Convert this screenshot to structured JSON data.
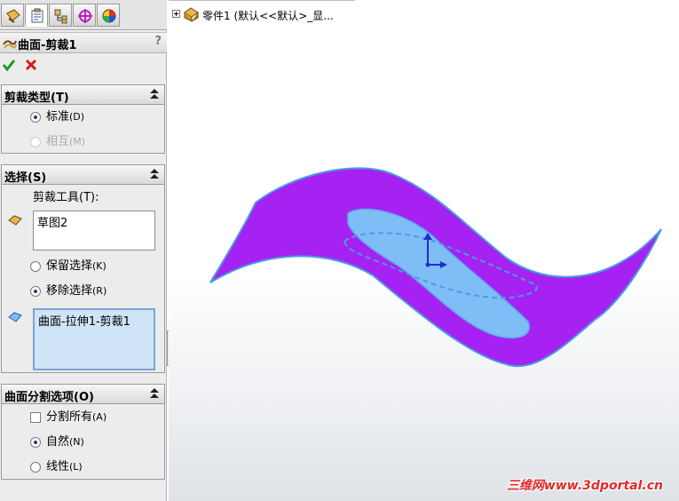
{
  "property_manager": {
    "title": "曲面-剪裁1",
    "help": "?",
    "tabs": [
      "feature-manager-icon",
      "property-manager-icon",
      "configuration-manager-icon",
      "dimxpert-icon",
      "display-manager-icon"
    ]
  },
  "trim_type": {
    "title": "剪裁类型(T)",
    "standard": {
      "label": "标准",
      "hotkey": "(D)",
      "selected": true
    },
    "mutual": {
      "label": "相互",
      "hotkey": "(M)",
      "selected": false,
      "enabled": false
    }
  },
  "selection": {
    "title": "选择(S)",
    "trim_tool_label": "剪裁工具(T):",
    "trim_tool_value": "草图2",
    "keep": {
      "label": "保留选择",
      "hotkey": "(K)",
      "selected": false
    },
    "remove": {
      "label": "移除选择",
      "hotkey": "(R)",
      "selected": true
    },
    "pieces_value": "曲面-拉伸1-剪裁1"
  },
  "split_options": {
    "title": "曲面分割选项(O)",
    "split_all": {
      "label": "分割所有",
      "hotkey": "(A)",
      "checked": false
    },
    "natural": {
      "label": "自然",
      "hotkey": "(N)",
      "selected": true
    },
    "linear": {
      "label": "线性",
      "hotkey": "(L)",
      "selected": false
    }
  },
  "feature_tree": {
    "part_label": "零件1 (默认<<默认>_显..."
  },
  "watermark": "三维网www.3dportal.cn",
  "colors": {
    "surface": "#a522f2",
    "selection_fill": "#7fbdf6",
    "edge": "#4a9be0",
    "triad_blue": "#1e2fd0"
  }
}
